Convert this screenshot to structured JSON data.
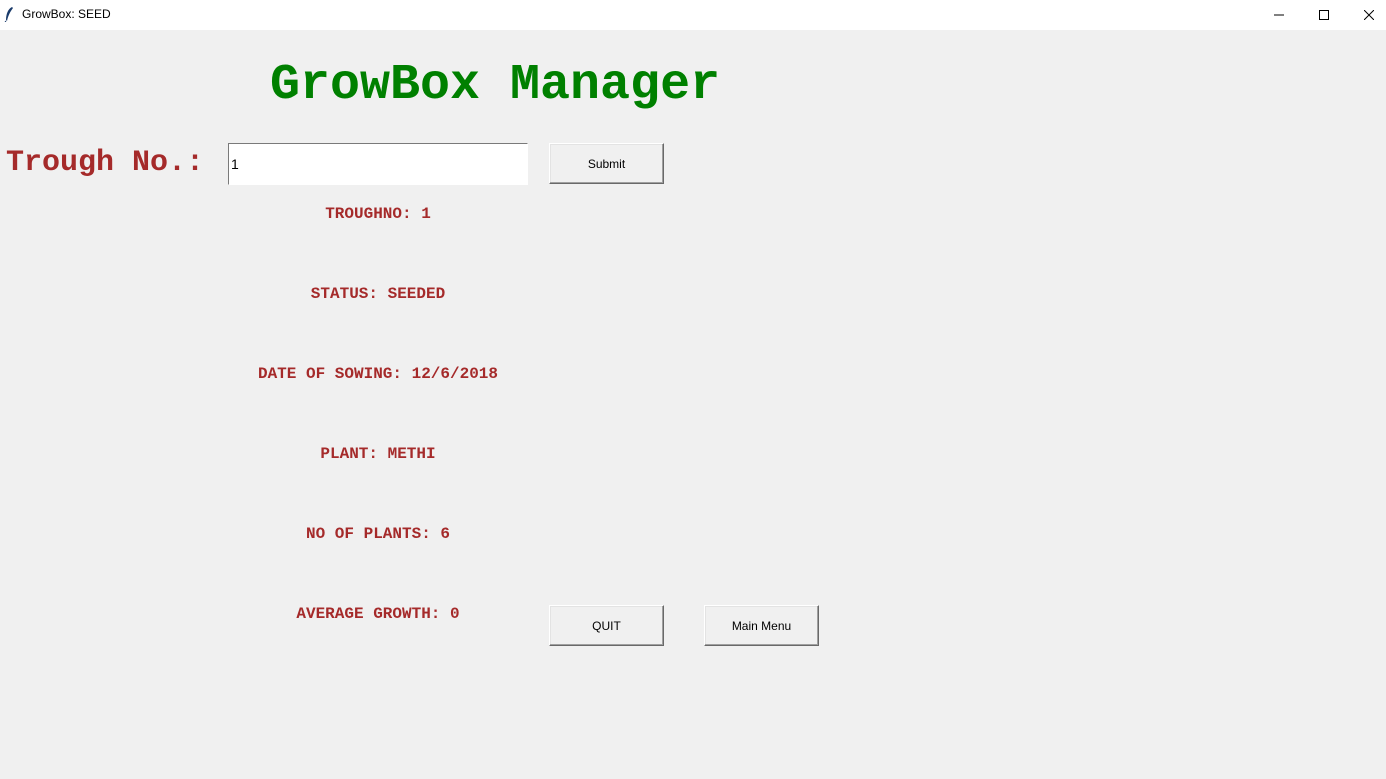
{
  "window": {
    "title": "GrowBox: SEED",
    "icon": "feather-icon",
    "controls": [
      "minimize-icon",
      "maximize-icon",
      "close-icon"
    ]
  },
  "heading": "GrowBox Manager",
  "form": {
    "label": "Trough No.:",
    "value": "1",
    "submit_label": "Submit"
  },
  "info": {
    "troughno": "TROUGHNO: 1",
    "status": "STATUS: SEEDED",
    "date_of_sowing": "DATE OF SOWING: 12/6/2018",
    "plant": "PLANT: METHI",
    "no_of_plants": "NO OF PLANTS: 6",
    "average_growth": "AVERAGE GROWTH: 0"
  },
  "buttons": {
    "quit": "QUIT",
    "main_menu": "Main Menu"
  },
  "colors": {
    "heading": "#008000",
    "labels": "#a52a2a",
    "background": "#f0f0f0"
  }
}
